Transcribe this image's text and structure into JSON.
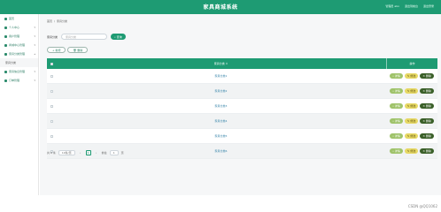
{
  "app": {
    "title": "家具商城系统",
    "top_links": [
      "管理员 abo",
      "退出到前台",
      "退出登录"
    ]
  },
  "sidebar": {
    "items": [
      {
        "label": "首页"
      },
      {
        "label": "个人中心"
      },
      {
        "label": "用户管理"
      },
      {
        "label": "商城中心管理"
      },
      {
        "label": "家具分类管理"
      },
      {
        "label": "家具分类",
        "sub": true
      },
      {
        "label": "家具信息管理"
      },
      {
        "label": "订单管理"
      }
    ]
  },
  "breadcrumb": {
    "home": "首页",
    "sep": "/",
    "current": "家具分类"
  },
  "search": {
    "label": "家具分类",
    "placeholder": "家具分类",
    "button": "查询"
  },
  "actions": {
    "add": "+ 新增",
    "delete": "删除"
  },
  "table": {
    "header_name": "家具分类 ↕",
    "header_ops": "操作",
    "rows": [
      {
        "name": "家具分类1"
      },
      {
        "name": "家具分类2"
      },
      {
        "name": "家具分类3"
      },
      {
        "name": "家具分类4"
      },
      {
        "name": "家具分类5"
      },
      {
        "name": "家具分类6"
      }
    ],
    "ops": {
      "detail": "详情",
      "edit": "修改",
      "delete": "删除"
    }
  },
  "pager": {
    "total": "共 6 条",
    "per_page": "10条/页",
    "prev": "‹",
    "page": "1",
    "next": "›",
    "goto": "前往",
    "goto_value": "1",
    "page_suffix": "页"
  },
  "watermark": "CSDN @QQ1062"
}
